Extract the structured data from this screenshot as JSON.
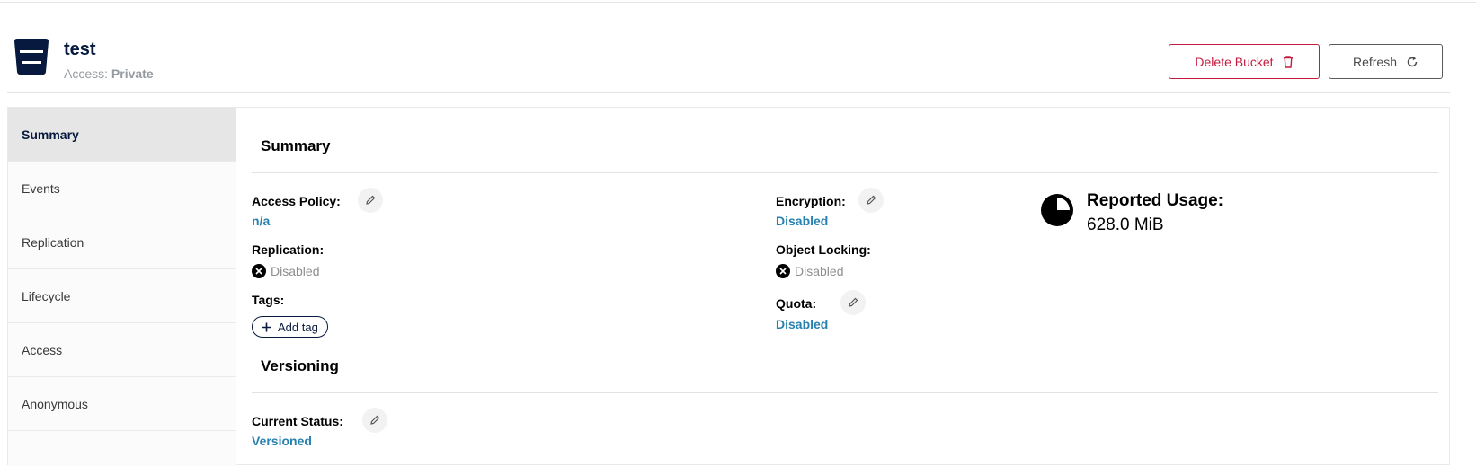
{
  "bucket": {
    "name": "test",
    "access_label": "Access:",
    "access_value": "Private"
  },
  "toolbar": {
    "delete_label": "Delete Bucket",
    "refresh_label": "Refresh"
  },
  "sidebar": {
    "items": [
      {
        "label": "Summary",
        "active": true
      },
      {
        "label": "Events"
      },
      {
        "label": "Replication"
      },
      {
        "label": "Lifecycle"
      },
      {
        "label": "Access"
      },
      {
        "label": "Anonymous"
      }
    ]
  },
  "summary": {
    "title": "Summary",
    "access_policy_label": "Access Policy:",
    "access_policy_value": "n/a",
    "replication_label": "Replication:",
    "replication_value": "Disabled",
    "tags_label": "Tags:",
    "add_tag_label": "Add tag",
    "encryption_label": "Encryption:",
    "encryption_value": "Disabled",
    "object_locking_label": "Object Locking:",
    "object_locking_value": "Disabled",
    "quota_label": "Quota:",
    "quota_value": "Disabled",
    "usage_label": "Reported Usage:",
    "usage_value": "628.0 MiB"
  },
  "versioning": {
    "title": "Versioning",
    "current_status_label": "Current Status:",
    "current_status_value": "Versioned"
  },
  "colors": {
    "brand_navy": "#07193e",
    "link_blue": "#2781b0",
    "danger_red": "#c51b3f"
  }
}
